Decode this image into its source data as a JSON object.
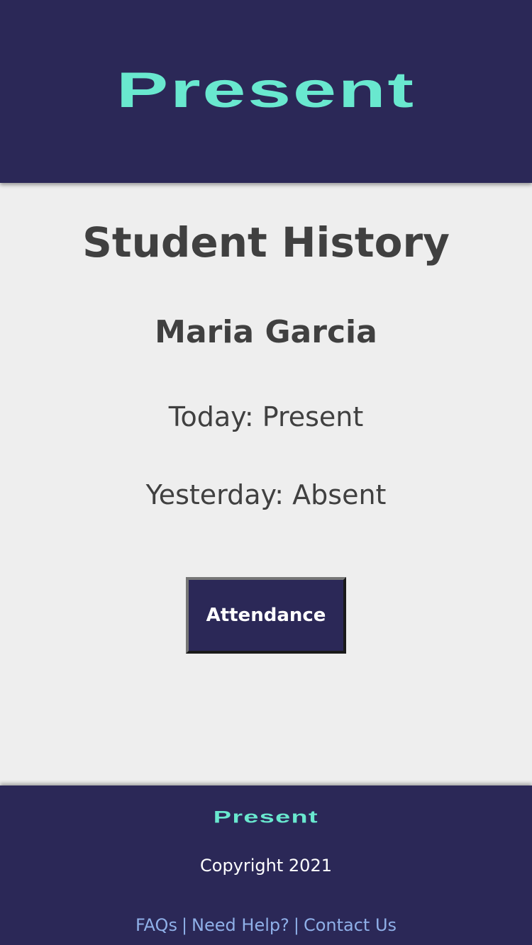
{
  "header": {
    "logo_text": "Present"
  },
  "main": {
    "page_title": "Student History",
    "student_name": "Maria Garcia",
    "today_status": "Today: Present",
    "yesterday_status": "Yesterday: Absent",
    "attendance_button_label": "Attendance"
  },
  "footer": {
    "logo_text": "Present",
    "copyright": "Copyright 2021",
    "links": [
      "FAQs",
      "Need Help?",
      "Contact Us"
    ],
    "separator": "|"
  },
  "colors": {
    "brand_navy": "#2b2857",
    "brand_teal": "#69e8cf",
    "background": "#eeeeee",
    "text": "#404040",
    "link": "#8fb0e8"
  }
}
